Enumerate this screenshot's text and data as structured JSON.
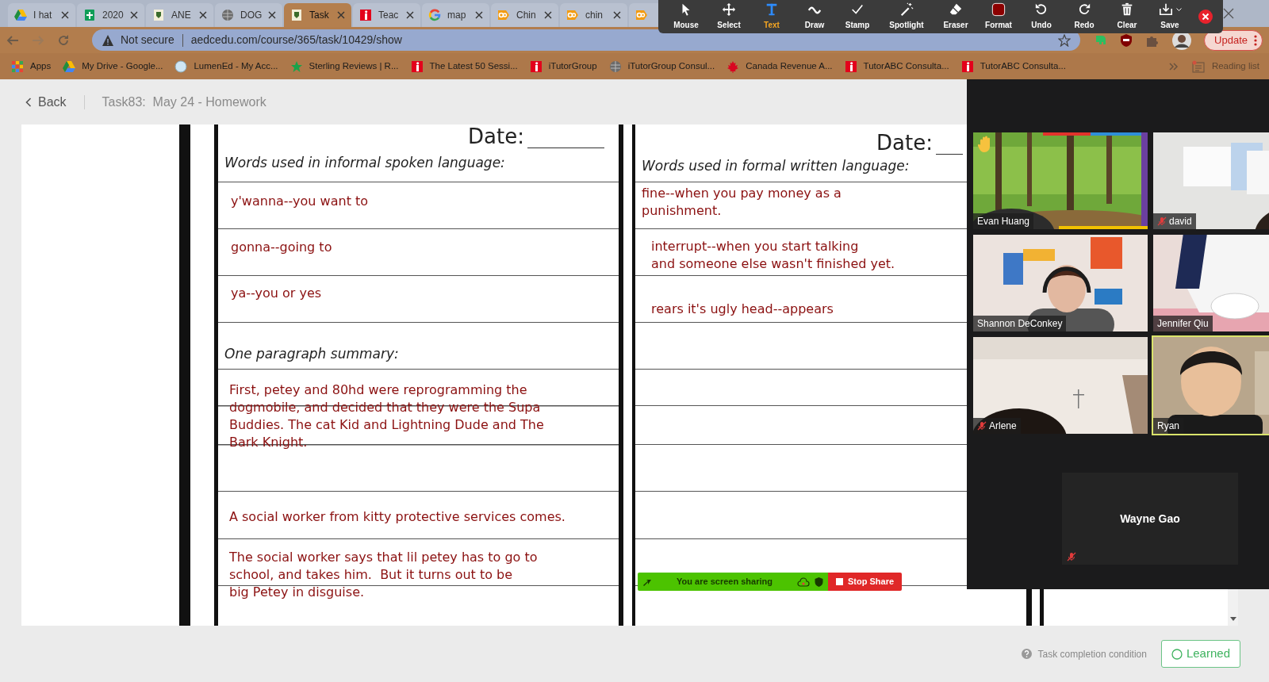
{
  "browser": {
    "tabs": [
      {
        "label": "I hat",
        "kind": "drive",
        "selected": false
      },
      {
        "label": "2020",
        "kind": "sheets",
        "selected": false
      },
      {
        "label": "ANE",
        "kind": "crest",
        "selected": false
      },
      {
        "label": "DOG",
        "kind": "globe",
        "selected": false
      },
      {
        "label": "Task",
        "kind": "crest",
        "selected": true
      },
      {
        "label": "Teac",
        "kind": "itutor",
        "selected": false
      },
      {
        "label": "map",
        "kind": "google",
        "selected": false
      },
      {
        "label": "Chin",
        "kind": "ds",
        "selected": false
      },
      {
        "label": "chin",
        "kind": "ds",
        "selected": false
      },
      {
        "kind": "ds",
        "selected": false
      }
    ],
    "security": "Not secure",
    "url": "aedcedu.com/course/365/task/10429/show",
    "update": "Update",
    "bookmarks": [
      {
        "label": "Apps",
        "kind": "apps"
      },
      {
        "label": "My Drive - Google...",
        "kind": "drive"
      },
      {
        "label": "LumenEd - My Acc...",
        "kind": "lumened"
      },
      {
        "label": "Sterling Reviews | R...",
        "kind": "star"
      },
      {
        "label": "The Latest 50 Sessi...",
        "kind": "itutor"
      },
      {
        "label": "iTutorGroup",
        "kind": "itutor"
      },
      {
        "label": "iTutorGroup Consul...",
        "kind": "globe"
      },
      {
        "label": "Canada Revenue A...",
        "kind": "maple"
      },
      {
        "label": "TutorABC Consulta...",
        "kind": "itutor"
      },
      {
        "label": "TutorABC Consulta...",
        "kind": "itutor"
      }
    ],
    "reading_list": "Reading list"
  },
  "annotation_toolbar": {
    "tools": [
      {
        "label": "Mouse",
        "kind": "mouse",
        "selected": false
      },
      {
        "label": "Select",
        "kind": "select",
        "selected": false
      },
      {
        "label": "Text",
        "kind": "text",
        "selected": true
      },
      {
        "label": "Draw",
        "kind": "draw",
        "selected": false
      },
      {
        "label": "Stamp",
        "kind": "stamp",
        "selected": false
      },
      {
        "label": "Spotlight",
        "kind": "spotlight",
        "selected": false
      },
      {
        "label": "Eraser",
        "kind": "eraser",
        "selected": false
      },
      {
        "label": "Format",
        "kind": "format",
        "selected": false,
        "color": "#8b0000"
      },
      {
        "label": "Undo",
        "kind": "undo",
        "selected": false
      },
      {
        "label": "Redo",
        "kind": "redo",
        "selected": false
      },
      {
        "label": "Clear",
        "kind": "clear",
        "selected": false
      },
      {
        "label": "Save",
        "kind": "save",
        "selected": false
      }
    ]
  },
  "page": {
    "back": "Back",
    "title": "Task83:  May 24 - Homework"
  },
  "worksheet": {
    "left": {
      "date": "Date:",
      "heading": "Words used in informal spoken language:",
      "entries": [
        "y'wanna--you want to",
        "gonna--going to",
        "ya--you or yes"
      ],
      "summary_heading": "One paragraph summary:",
      "summary": [
        "First, petey and 80hd were reprogramming the\ndogmobile, and decided that they were the Supa\nBuddies. The cat Kid and Lightning Dude and The\nBark Knight.",
        "A social worker from kitty protective services comes.",
        "The social worker says that lil petey has to go to\nschool, and takes him.  But it turns out to be\nbig Petey in disguise."
      ]
    },
    "right": {
      "date": "Date:",
      "heading": "Words used in formal written language:",
      "entries": [
        "fine--when you pay money as a\npunishment.",
        "interrupt--when you start talking\nand someone else wasn't finished yet.",
        "rears it's ugly head--appears"
      ]
    }
  },
  "meeting": {
    "participants": [
      {
        "name": "Evan Huang",
        "muted": false,
        "hand_raised": true,
        "speaking": false
      },
      {
        "name": "david",
        "muted": true,
        "hand_raised": false,
        "speaking": false
      },
      {
        "name": "Shannon DeConkey",
        "muted": false,
        "hand_raised": false,
        "speaking": false
      },
      {
        "name": "Jennifer Qiu",
        "muted": false,
        "hand_raised": false,
        "speaking": false
      },
      {
        "name": "Arlene",
        "muted": true,
        "hand_raised": false,
        "speaking": false
      },
      {
        "name": "Ryan",
        "muted": false,
        "hand_raised": false,
        "speaking": true
      }
    ],
    "camera_off": {
      "name": "Wayne Gao",
      "muted": true
    }
  },
  "share_bar": {
    "status": "You are screen sharing",
    "stop": "Stop Share"
  },
  "footer": {
    "condition": "Task completion condition",
    "learned": "Learned"
  }
}
